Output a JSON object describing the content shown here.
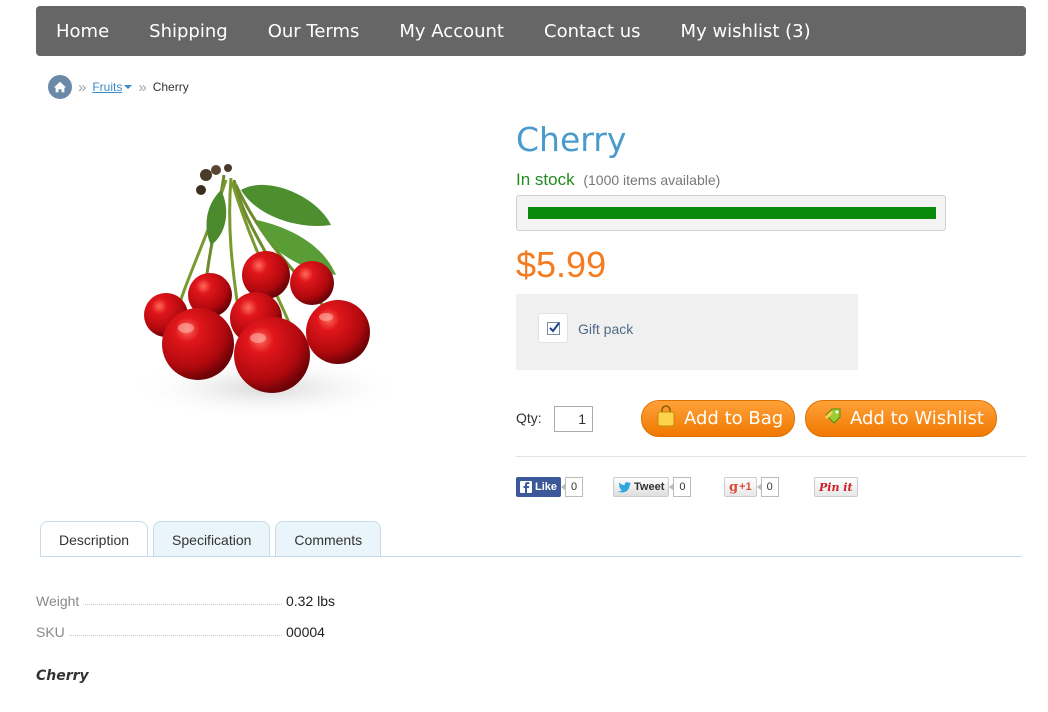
{
  "nav": {
    "items": [
      "Home",
      "Shipping",
      "Our Terms",
      "My Account",
      "Contact us",
      "My wishlist (3)"
    ]
  },
  "breadcrumb": {
    "home_icon": "home-icon",
    "category": "Fruits",
    "separator": "»",
    "current": "Cherry"
  },
  "product": {
    "title": "Cherry",
    "stock_status": "In stock",
    "stock_count": "(1000 items available)",
    "stock_level_fraction": 1.0,
    "price": "$5.99",
    "gift_pack_label": "Gift pack",
    "gift_pack_checked": true,
    "qty_label": "Qty:",
    "qty_value": "1",
    "add_to_bag_label": "Add to Bag",
    "add_to_wishlist_label": "Add to Wishlist",
    "image_icon": "cherries-image"
  },
  "social": {
    "facebook": {
      "label": "Like",
      "count": "0"
    },
    "twitter": {
      "label": "Tweet",
      "count": "0"
    },
    "googleplus": {
      "label": "+1",
      "count": "0"
    },
    "pinterest": {
      "label": "Pin it"
    }
  },
  "tabs": [
    "Description",
    "Specification",
    "Comments"
  ],
  "active_tab": "Description",
  "specs": [
    {
      "key": "Weight",
      "value": "0.32 lbs"
    },
    {
      "key": "SKU",
      "value": "00004"
    }
  ],
  "description_title": "Cherry",
  "colors": {
    "nav_bg": "#666666",
    "title": "#4a9acd",
    "price": "#f47b20",
    "stock": "#228b22",
    "button": "#f58a0f"
  }
}
